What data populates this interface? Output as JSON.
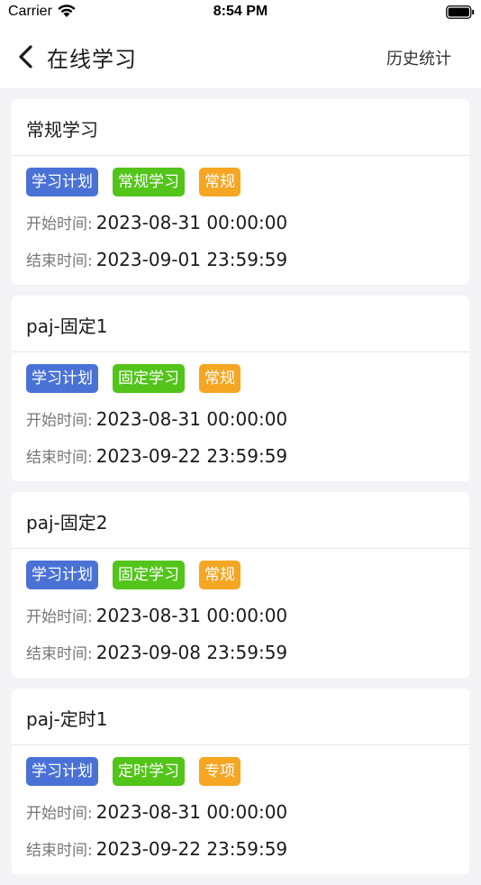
{
  "status_bar": {
    "carrier": "Carrier",
    "time": "8:54 PM"
  },
  "nav": {
    "title": "在线学习",
    "action": "历史统计"
  },
  "labels": {
    "start": "开始时间:",
    "end": "结束时间:"
  },
  "colors": {
    "plan": "#4a72d6",
    "type": "#52c41a",
    "category": "#f5a623"
  },
  "cards": [
    {
      "title": "常规学习",
      "tags": [
        "学习计划",
        "常规学习",
        "常规"
      ],
      "start": "2023-08-31 00:00:00",
      "end": "2023-09-01 23:59:59"
    },
    {
      "title": "paj-固定1",
      "tags": [
        "学习计划",
        "固定学习",
        "常规"
      ],
      "start": "2023-08-31 00:00:00",
      "end": "2023-09-22 23:59:59"
    },
    {
      "title": "paj-固定2",
      "tags": [
        "学习计划",
        "固定学习",
        "常规"
      ],
      "start": "2023-08-31 00:00:00",
      "end": "2023-09-08 23:59:59"
    },
    {
      "title": "paj-定时1",
      "tags": [
        "学习计划",
        "定时学习",
        "专项"
      ],
      "start": "2023-08-31 00:00:00",
      "end": "2023-09-22 23:59:59"
    }
  ]
}
